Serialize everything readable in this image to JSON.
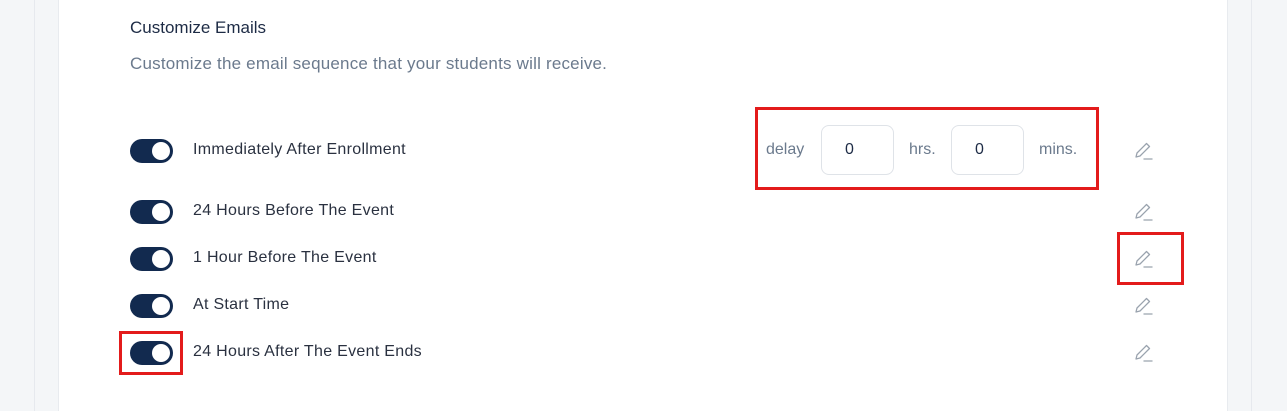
{
  "section": {
    "title": "Customize Emails",
    "subtitle": "Customize the email sequence that your students will receive."
  },
  "delay": {
    "delay_label": "delay",
    "hours_value": "0",
    "hours_unit": "hrs.",
    "minutes_value": "0",
    "minutes_unit": "mins."
  },
  "emails": [
    {
      "label": "Immediately After Enrollment",
      "enabled": true,
      "edit_icon": "pencil-icon"
    },
    {
      "label": "24 Hours Before The Event",
      "enabled": true,
      "edit_icon": "pencil-icon"
    },
    {
      "label": "1 Hour Before The Event",
      "enabled": true,
      "edit_icon": "pencil-icon"
    },
    {
      "label": "At Start Time",
      "enabled": true,
      "edit_icon": "pencil-icon"
    },
    {
      "label": "24 Hours After The Event Ends",
      "enabled": true,
      "edit_icon": "pencil-icon"
    }
  ],
  "colors": {
    "toggle_on": "#122a4f",
    "highlight": "#e31b1b",
    "title": "#1d2b45",
    "muted": "#6b7a8d"
  }
}
